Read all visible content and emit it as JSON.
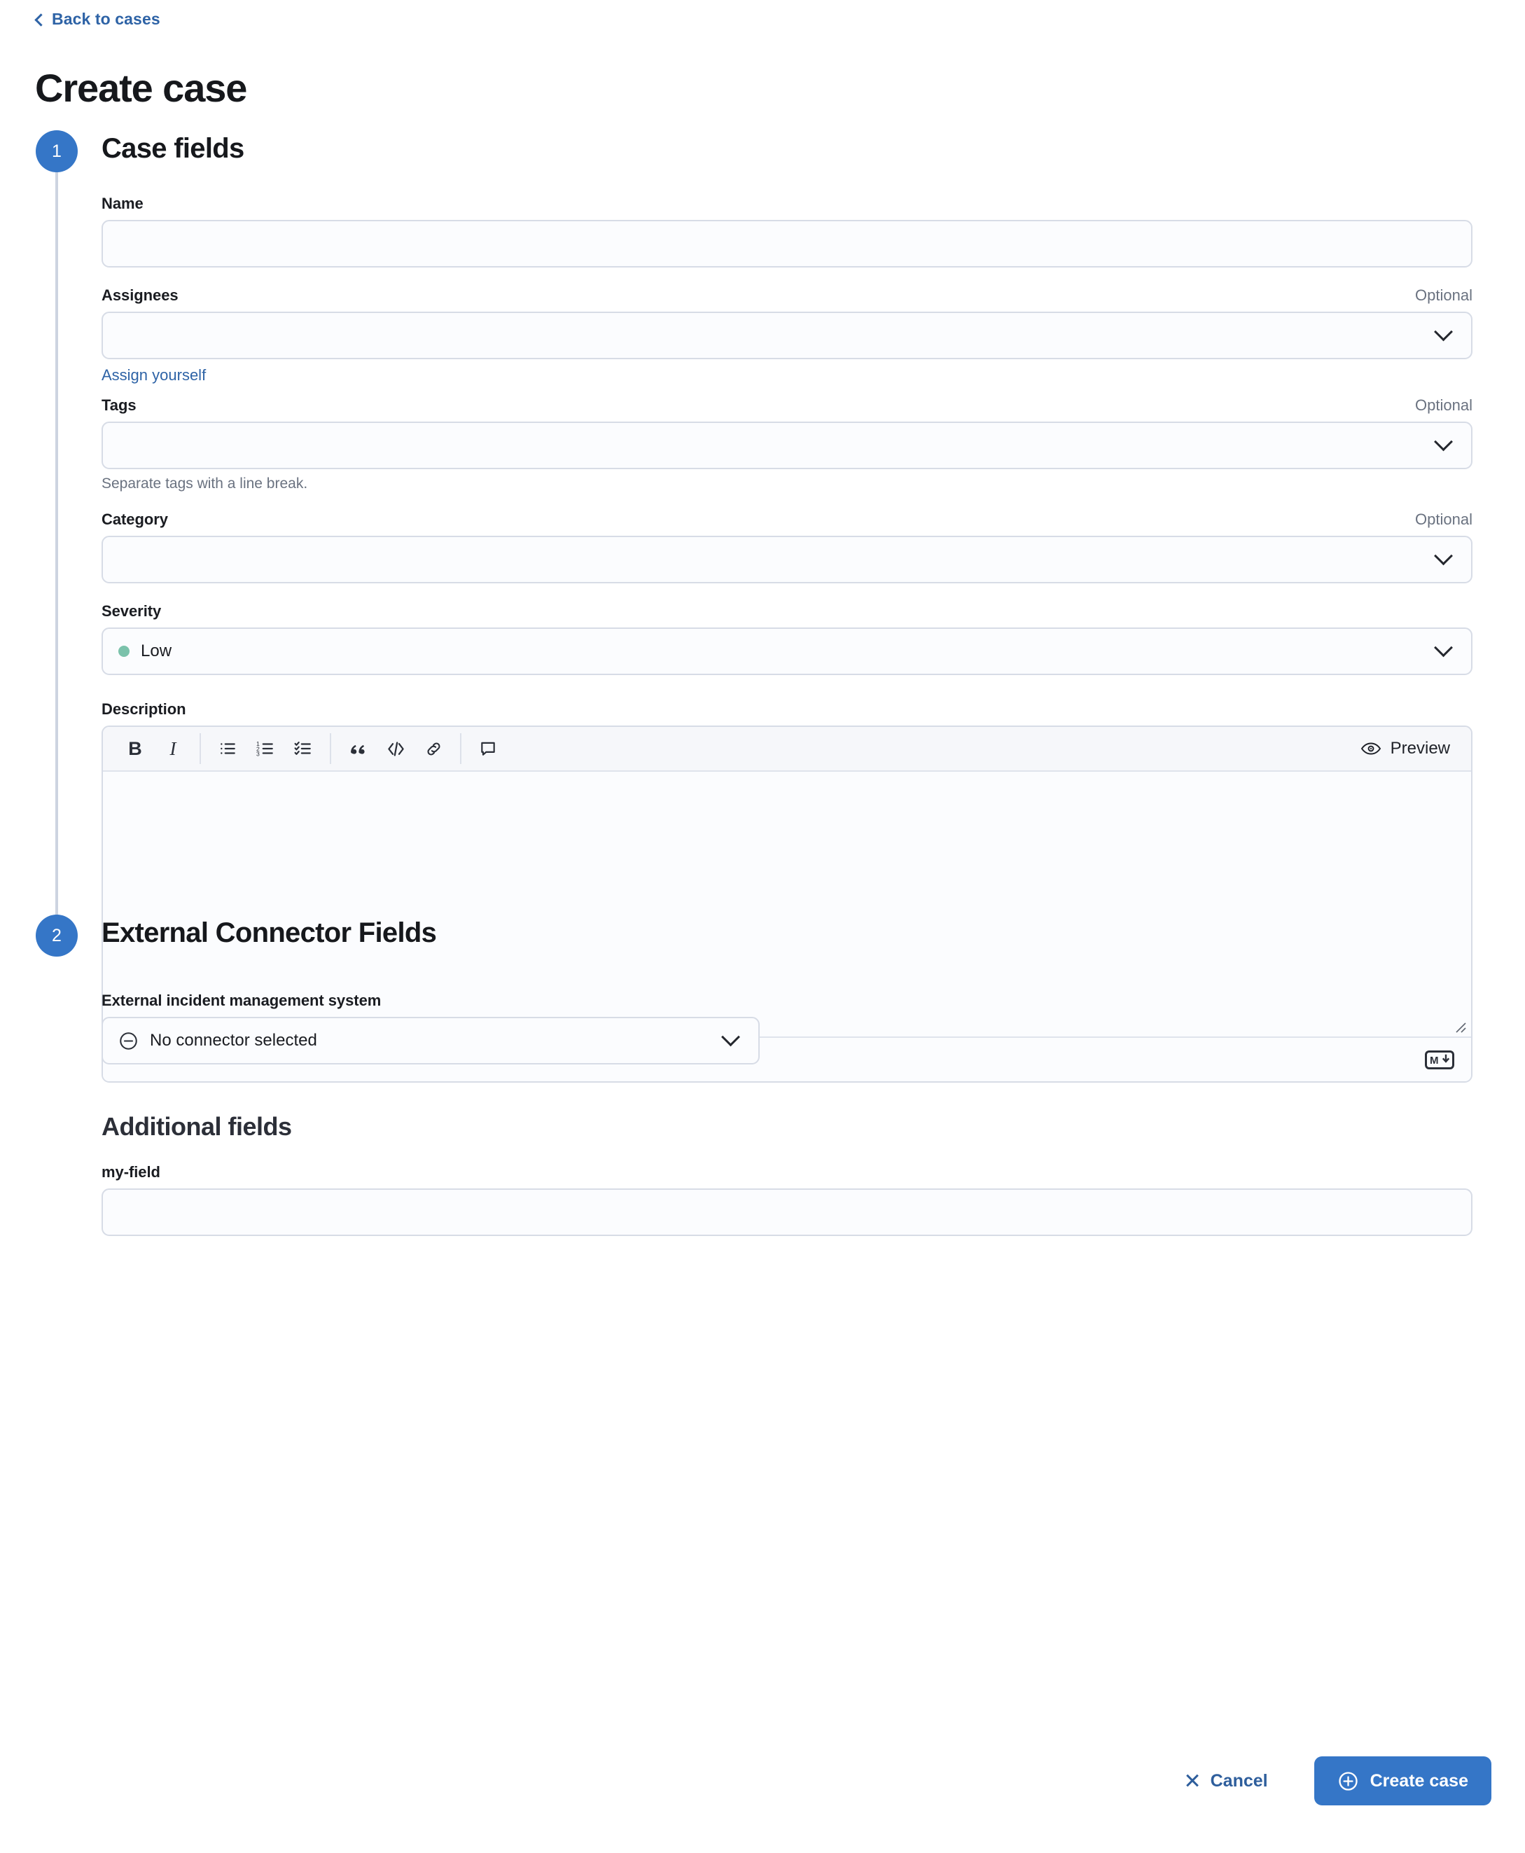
{
  "header": {
    "back_link": "Back to cases",
    "back_icon": "chevron-left-icon",
    "title": "Create case"
  },
  "steps": [
    {
      "number": "1",
      "title": "Case fields"
    },
    {
      "number": "2",
      "title": "External Connector Fields"
    }
  ],
  "case_fields": {
    "name": {
      "label": "Name",
      "value": "",
      "placeholder": ""
    },
    "assignees": {
      "label": "Assignees",
      "optional": "Optional",
      "value": "",
      "placeholder": "",
      "link": "Assign yourself"
    },
    "tags": {
      "label": "Tags",
      "optional": "Optional",
      "value": "",
      "placeholder": "",
      "help": "Separate tags with a line break."
    },
    "category": {
      "label": "Category",
      "optional": "Optional",
      "value": "",
      "placeholder": ""
    },
    "severity": {
      "label": "Severity",
      "value": "Low",
      "dot_color": "#7bc2ab"
    },
    "description": {
      "label": "Description",
      "value": "",
      "placeholder": "",
      "preview_label": "Preview",
      "preview_icon": "eye-icon",
      "markdown_badge": "markdown-icon",
      "toolbar": [
        {
          "name": "bold-icon",
          "glyph": "B"
        },
        {
          "name": "italic-icon",
          "glyph": "I"
        },
        {
          "name": "bullet-list-icon",
          "glyph": ""
        },
        {
          "name": "ordered-list-icon",
          "glyph": ""
        },
        {
          "name": "checklist-icon",
          "glyph": ""
        },
        {
          "name": "blockquote-icon",
          "glyph": ""
        },
        {
          "name": "code-block-icon",
          "glyph": ""
        },
        {
          "name": "link-icon",
          "glyph": ""
        },
        {
          "name": "comment-icon",
          "glyph": ""
        }
      ]
    }
  },
  "additional_fields": {
    "heading": "Additional fields",
    "fields": [
      {
        "label": "my-field",
        "value": "",
        "placeholder": ""
      }
    ]
  },
  "external_connector": {
    "label": "External incident management system",
    "value": "No connector selected",
    "icon": "minus-circle-icon"
  },
  "footer": {
    "cancel_label": "Cancel",
    "cancel_icon": "close-icon",
    "create_label": "Create case",
    "create_icon": "plus-circle-icon"
  },
  "colors": {
    "accent": "#3576c7",
    "link": "#2e63a6",
    "cancel_text": "#2e5e9c",
    "border": "#d7dce6",
    "field_bg": "#fbfcfe",
    "muted_text": "#6a7280",
    "severity_low": "#7bc2ab"
  }
}
